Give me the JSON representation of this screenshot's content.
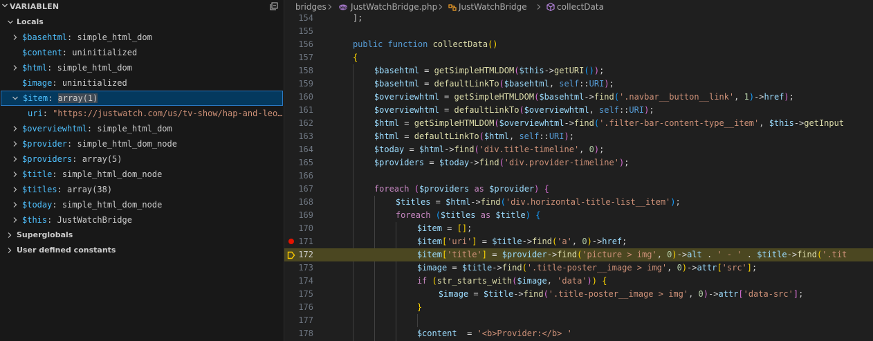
{
  "panel": {
    "title": "VARIABLEN",
    "groups": [
      {
        "label": "Locals",
        "expanded": true
      },
      {
        "label": "Superglobals",
        "expanded": false
      },
      {
        "label": "User defined constants",
        "expanded": false
      }
    ],
    "locals": [
      {
        "name": "$basehtml",
        "value": "simple_html_dom",
        "expandable": true,
        "expanded": false,
        "kind": "obj"
      },
      {
        "name": "$content",
        "value": "uninitialized",
        "expandable": false,
        "kind": "plain"
      },
      {
        "name": "$html",
        "value": "simple_html_dom",
        "expandable": true,
        "expanded": false,
        "kind": "obj"
      },
      {
        "name": "$image",
        "value": "uninitialized",
        "expandable": false,
        "kind": "plain"
      },
      {
        "name": "$item",
        "value": "array(1)",
        "expandable": true,
        "expanded": true,
        "kind": "obj",
        "selected": true
      },
      {
        "name": "uri",
        "value": "\"https://justwatch.com/us/tv-show/hap-and-leo…",
        "expandable": false,
        "kind": "string",
        "child": true
      },
      {
        "name": "$overviewhtml",
        "value": "simple_html_dom",
        "expandable": true,
        "expanded": false,
        "kind": "obj"
      },
      {
        "name": "$provider",
        "value": "simple_html_dom_node",
        "expandable": true,
        "expanded": false,
        "kind": "obj"
      },
      {
        "name": "$providers",
        "value": "array(5)",
        "expandable": true,
        "expanded": false,
        "kind": "obj"
      },
      {
        "name": "$title",
        "value": "simple_html_dom_node",
        "expandable": true,
        "expanded": false,
        "kind": "obj"
      },
      {
        "name": "$titles",
        "value": "array(38)",
        "expandable": true,
        "expanded": false,
        "kind": "obj"
      },
      {
        "name": "$today",
        "value": "simple_html_dom_node",
        "expandable": true,
        "expanded": false,
        "kind": "obj"
      },
      {
        "name": "$this",
        "value": "JustWatchBridge",
        "expandable": true,
        "expanded": false,
        "kind": "obj"
      }
    ]
  },
  "breadcrumb": {
    "folder": "bridges",
    "file": "JustWatchBridge.php",
    "class": "JustWatchBridge",
    "method": "collectData"
  },
  "editor": {
    "breakpoint_line": 171,
    "current_line": 172,
    "lines": [
      {
        "n": "154",
        "indent": 4,
        "t": [
          [
            "];",
            "pl"
          ]
        ]
      },
      {
        "n": "155",
        "indent": 0,
        "t": []
      },
      {
        "n": "156",
        "indent": 4,
        "t": [
          [
            "public",
            "st"
          ],
          [
            " ",
            "pl"
          ],
          [
            "function",
            "st"
          ],
          [
            " ",
            "pl"
          ],
          [
            "collectData",
            "fn"
          ],
          [
            "()",
            "br1"
          ]
        ]
      },
      {
        "n": "157",
        "indent": 4,
        "t": [
          [
            "{",
            "br1"
          ]
        ]
      },
      {
        "n": "158",
        "indent": 8,
        "t": [
          [
            "$basehtml",
            "vr"
          ],
          [
            " = ",
            "op"
          ],
          [
            "getSimpleHTMLDOM",
            "fn"
          ],
          [
            "(",
            "br2"
          ],
          [
            "$this",
            "vr"
          ],
          [
            "->",
            "op"
          ],
          [
            "getURI",
            "fn"
          ],
          [
            "()",
            "br3"
          ],
          [
            ")",
            "br2"
          ],
          [
            ";",
            "pl"
          ]
        ]
      },
      {
        "n": "159",
        "indent": 8,
        "t": [
          [
            "$basehtml",
            "vr"
          ],
          [
            " = ",
            "op"
          ],
          [
            "defaultLinkTo",
            "fn"
          ],
          [
            "(",
            "br2"
          ],
          [
            "$basehtml",
            "vr"
          ],
          [
            ", ",
            "pl"
          ],
          [
            "self",
            "st"
          ],
          [
            "::",
            "op"
          ],
          [
            "URI",
            "cn"
          ],
          [
            ")",
            "br2"
          ],
          [
            ";",
            "pl"
          ]
        ]
      },
      {
        "n": "160",
        "indent": 8,
        "t": [
          [
            "$overviewhtml",
            "vr"
          ],
          [
            " = ",
            "op"
          ],
          [
            "getSimpleHTMLDOM",
            "fn"
          ],
          [
            "(",
            "br2"
          ],
          [
            "$basehtml",
            "vr"
          ],
          [
            "->",
            "op"
          ],
          [
            "find",
            "fn"
          ],
          [
            "(",
            "br3"
          ],
          [
            "'.navbar__button__link'",
            "s"
          ],
          [
            ", ",
            "pl"
          ],
          [
            "1",
            "n"
          ],
          [
            ")",
            "br3"
          ],
          [
            "->",
            "op"
          ],
          [
            "href",
            "vr"
          ],
          [
            ")",
            "br2"
          ],
          [
            ";",
            "pl"
          ]
        ]
      },
      {
        "n": "161",
        "indent": 8,
        "t": [
          [
            "$overviewhtml",
            "vr"
          ],
          [
            " = ",
            "op"
          ],
          [
            "defaultLinkTo",
            "fn"
          ],
          [
            "(",
            "br2"
          ],
          [
            "$overviewhtml",
            "vr"
          ],
          [
            ", ",
            "pl"
          ],
          [
            "self",
            "st"
          ],
          [
            "::",
            "op"
          ],
          [
            "URI",
            "cn"
          ],
          [
            ")",
            "br2"
          ],
          [
            ";",
            "pl"
          ]
        ]
      },
      {
        "n": "162",
        "indent": 8,
        "t": [
          [
            "$html",
            "vr"
          ],
          [
            " = ",
            "op"
          ],
          [
            "getSimpleHTMLDOM",
            "fn"
          ],
          [
            "(",
            "br2"
          ],
          [
            "$overviewhtml",
            "vr"
          ],
          [
            "->",
            "op"
          ],
          [
            "find",
            "fn"
          ],
          [
            "(",
            "br3"
          ],
          [
            "'.filter-bar-content-type__item'",
            "s"
          ],
          [
            ", ",
            "pl"
          ],
          [
            "$this",
            "vr"
          ],
          [
            "->",
            "op"
          ],
          [
            "getInput",
            "fn"
          ]
        ]
      },
      {
        "n": "163",
        "indent": 8,
        "t": [
          [
            "$html",
            "vr"
          ],
          [
            " = ",
            "op"
          ],
          [
            "defaultLinkTo",
            "fn"
          ],
          [
            "(",
            "br2"
          ],
          [
            "$html",
            "vr"
          ],
          [
            ", ",
            "pl"
          ],
          [
            "self",
            "st"
          ],
          [
            "::",
            "op"
          ],
          [
            "URI",
            "cn"
          ],
          [
            ")",
            "br2"
          ],
          [
            ";",
            "pl"
          ]
        ]
      },
      {
        "n": "164",
        "indent": 8,
        "t": [
          [
            "$today",
            "vr"
          ],
          [
            " = ",
            "op"
          ],
          [
            "$html",
            "vr"
          ],
          [
            "->",
            "op"
          ],
          [
            "find",
            "fn"
          ],
          [
            "(",
            "br2"
          ],
          [
            "'div.title-timeline'",
            "s"
          ],
          [
            ", ",
            "pl"
          ],
          [
            "0",
            "n"
          ],
          [
            ")",
            "br2"
          ],
          [
            ";",
            "pl"
          ]
        ]
      },
      {
        "n": "165",
        "indent": 8,
        "t": [
          [
            "$providers",
            "vr"
          ],
          [
            " = ",
            "op"
          ],
          [
            "$today",
            "vr"
          ],
          [
            "->",
            "op"
          ],
          [
            "find",
            "fn"
          ],
          [
            "(",
            "br2"
          ],
          [
            "'div.provider-timeline'",
            "s"
          ],
          [
            ")",
            "br2"
          ],
          [
            ";",
            "pl"
          ]
        ]
      },
      {
        "n": "166",
        "indent": 0,
        "t": []
      },
      {
        "n": "167",
        "indent": 8,
        "t": [
          [
            "foreach",
            "kw"
          ],
          [
            " ",
            "pl"
          ],
          [
            "(",
            "br2"
          ],
          [
            "$providers",
            "vr"
          ],
          [
            " ",
            "pl"
          ],
          [
            "as",
            "kw"
          ],
          [
            " ",
            "pl"
          ],
          [
            "$provider",
            "vr"
          ],
          [
            ")",
            "br2"
          ],
          [
            " ",
            "pl"
          ],
          [
            "{",
            "br2"
          ]
        ]
      },
      {
        "n": "168",
        "indent": 12,
        "t": [
          [
            "$titles",
            "vr"
          ],
          [
            " = ",
            "op"
          ],
          [
            "$html",
            "vr"
          ],
          [
            "->",
            "op"
          ],
          [
            "find",
            "fn"
          ],
          [
            "(",
            "br3"
          ],
          [
            "'div.horizontal-title-list__item'",
            "s"
          ],
          [
            ")",
            "br3"
          ],
          [
            ";",
            "pl"
          ]
        ]
      },
      {
        "n": "169",
        "indent": 12,
        "t": [
          [
            "foreach",
            "kw"
          ],
          [
            " ",
            "pl"
          ],
          [
            "(",
            "br3"
          ],
          [
            "$titles",
            "vr"
          ],
          [
            " ",
            "pl"
          ],
          [
            "as",
            "kw"
          ],
          [
            " ",
            "pl"
          ],
          [
            "$title",
            "vr"
          ],
          [
            ")",
            "br3"
          ],
          [
            " ",
            "pl"
          ],
          [
            "{",
            "br3"
          ]
        ]
      },
      {
        "n": "170",
        "indent": 16,
        "t": [
          [
            "$item",
            "vr"
          ],
          [
            " = ",
            "op"
          ],
          [
            "[]",
            "br1"
          ],
          [
            ";",
            "pl"
          ]
        ]
      },
      {
        "n": "171",
        "indent": 16,
        "t": [
          [
            "$item",
            "vr"
          ],
          [
            "[",
            "br1"
          ],
          [
            "'uri'",
            "s"
          ],
          [
            "]",
            "br1"
          ],
          [
            " = ",
            "op"
          ],
          [
            "$title",
            "vr"
          ],
          [
            "->",
            "op"
          ],
          [
            "find",
            "fn"
          ],
          [
            "(",
            "br1"
          ],
          [
            "'a'",
            "s"
          ],
          [
            ", ",
            "pl"
          ],
          [
            "0",
            "n"
          ],
          [
            ")",
            "br1"
          ],
          [
            "->",
            "op"
          ],
          [
            "href",
            "vr"
          ],
          [
            ";",
            "pl"
          ]
        ]
      },
      {
        "n": "172",
        "indent": 16,
        "t": [
          [
            "$item",
            "vr"
          ],
          [
            "[",
            "br1"
          ],
          [
            "'title'",
            "s"
          ],
          [
            "]",
            "br1"
          ],
          [
            " = ",
            "op"
          ],
          [
            "$provider",
            "vr"
          ],
          [
            "->",
            "op"
          ],
          [
            "find",
            "fn"
          ],
          [
            "(",
            "br1"
          ],
          [
            "'picture > img'",
            "s"
          ],
          [
            ", ",
            "pl"
          ],
          [
            "0",
            "n"
          ],
          [
            ")",
            "br1"
          ],
          [
            "->",
            "op"
          ],
          [
            "alt",
            "vr"
          ],
          [
            " . ",
            "op"
          ],
          [
            "' - '",
            "s"
          ],
          [
            " . ",
            "op"
          ],
          [
            "$title",
            "vr"
          ],
          [
            "->",
            "op"
          ],
          [
            "find",
            "fn"
          ],
          [
            "(",
            "br1"
          ],
          [
            "'.tit",
            "s"
          ]
        ]
      },
      {
        "n": "173",
        "indent": 16,
        "t": [
          [
            "$image",
            "vr"
          ],
          [
            " = ",
            "op"
          ],
          [
            "$title",
            "vr"
          ],
          [
            "->",
            "op"
          ],
          [
            "find",
            "fn"
          ],
          [
            "(",
            "br1"
          ],
          [
            "'.title-poster__image > img'",
            "s"
          ],
          [
            ", ",
            "pl"
          ],
          [
            "0",
            "n"
          ],
          [
            ")",
            "br1"
          ],
          [
            "->",
            "op"
          ],
          [
            "attr",
            "vr"
          ],
          [
            "[",
            "br1"
          ],
          [
            "'src'",
            "s"
          ],
          [
            "]",
            "br1"
          ],
          [
            ";",
            "pl"
          ]
        ]
      },
      {
        "n": "174",
        "indent": 16,
        "t": [
          [
            "if",
            "kw"
          ],
          [
            " ",
            "pl"
          ],
          [
            "(",
            "br1"
          ],
          [
            "str_starts_with",
            "fn"
          ],
          [
            "(",
            "br2"
          ],
          [
            "$image",
            "vr"
          ],
          [
            ", ",
            "pl"
          ],
          [
            "'data'",
            "s"
          ],
          [
            ")",
            "br2"
          ],
          [
            ")",
            "br1"
          ],
          [
            " ",
            "pl"
          ],
          [
            "{",
            "br1"
          ]
        ]
      },
      {
        "n": "175",
        "indent": 20,
        "t": [
          [
            "$image",
            "vr"
          ],
          [
            " = ",
            "op"
          ],
          [
            "$title",
            "vr"
          ],
          [
            "->",
            "op"
          ],
          [
            "find",
            "fn"
          ],
          [
            "(",
            "br2"
          ],
          [
            "'.title-poster__image > img'",
            "s"
          ],
          [
            ", ",
            "pl"
          ],
          [
            "0",
            "n"
          ],
          [
            ")",
            "br2"
          ],
          [
            "->",
            "op"
          ],
          [
            "attr",
            "vr"
          ],
          [
            "[",
            "br2"
          ],
          [
            "'data-src'",
            "s"
          ],
          [
            "]",
            "br2"
          ],
          [
            ";",
            "pl"
          ]
        ]
      },
      {
        "n": "176",
        "indent": 16,
        "t": [
          [
            "}",
            "br1"
          ]
        ]
      },
      {
        "n": "177",
        "indent": 0,
        "t": []
      },
      {
        "n": "178",
        "indent": 16,
        "t": [
          [
            "$content",
            "vr"
          ],
          [
            "  = ",
            "op"
          ],
          [
            "'<b>Provider:</b> '",
            "s"
          ]
        ]
      }
    ]
  },
  "colors": {
    "panel_bg": "#181818",
    "editor_bg": "#1f1f1f",
    "current_line_bg": "#4b4721",
    "selection_bg": "#04395e",
    "breakpoint": "#e51400",
    "instruction_pointer": "#ffcc00",
    "variable_name": "#4fc1ff"
  }
}
